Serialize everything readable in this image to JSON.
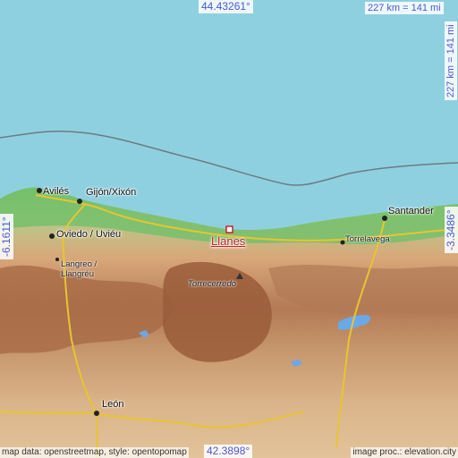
{
  "coords": {
    "top_latitude": "44.43261°",
    "bottom_latitude": "42.3898°",
    "left_longitude": "-6.1611°",
    "right_longitude": "-3.3486°"
  },
  "scale": {
    "horizontal": "227 km = 141 mi",
    "vertical": "227 km = 141 mi"
  },
  "places": {
    "main": "Llanes",
    "aviles": "Avilés",
    "gijon": "Gijón/Xixón",
    "santander": "Santander",
    "oviedo": "Oviedo / Uviéu",
    "torrelavega": "Torrelavega",
    "langreo1": "Langreo /",
    "langreo2": "Llangréu",
    "torrecerredo": "Torrecerredo",
    "leon": "León"
  },
  "credits": {
    "left": "map data: openstreetmap, style: opentopomap",
    "right": "image proc.: elevation.city"
  },
  "colors": {
    "sea": "#8fd0e0",
    "coast_green": "#7cc273",
    "mountain_brown": "#b47a55",
    "plateau": "#d9b48a",
    "label_blue": "#4a58d8",
    "marker_red": "#d0202a"
  }
}
